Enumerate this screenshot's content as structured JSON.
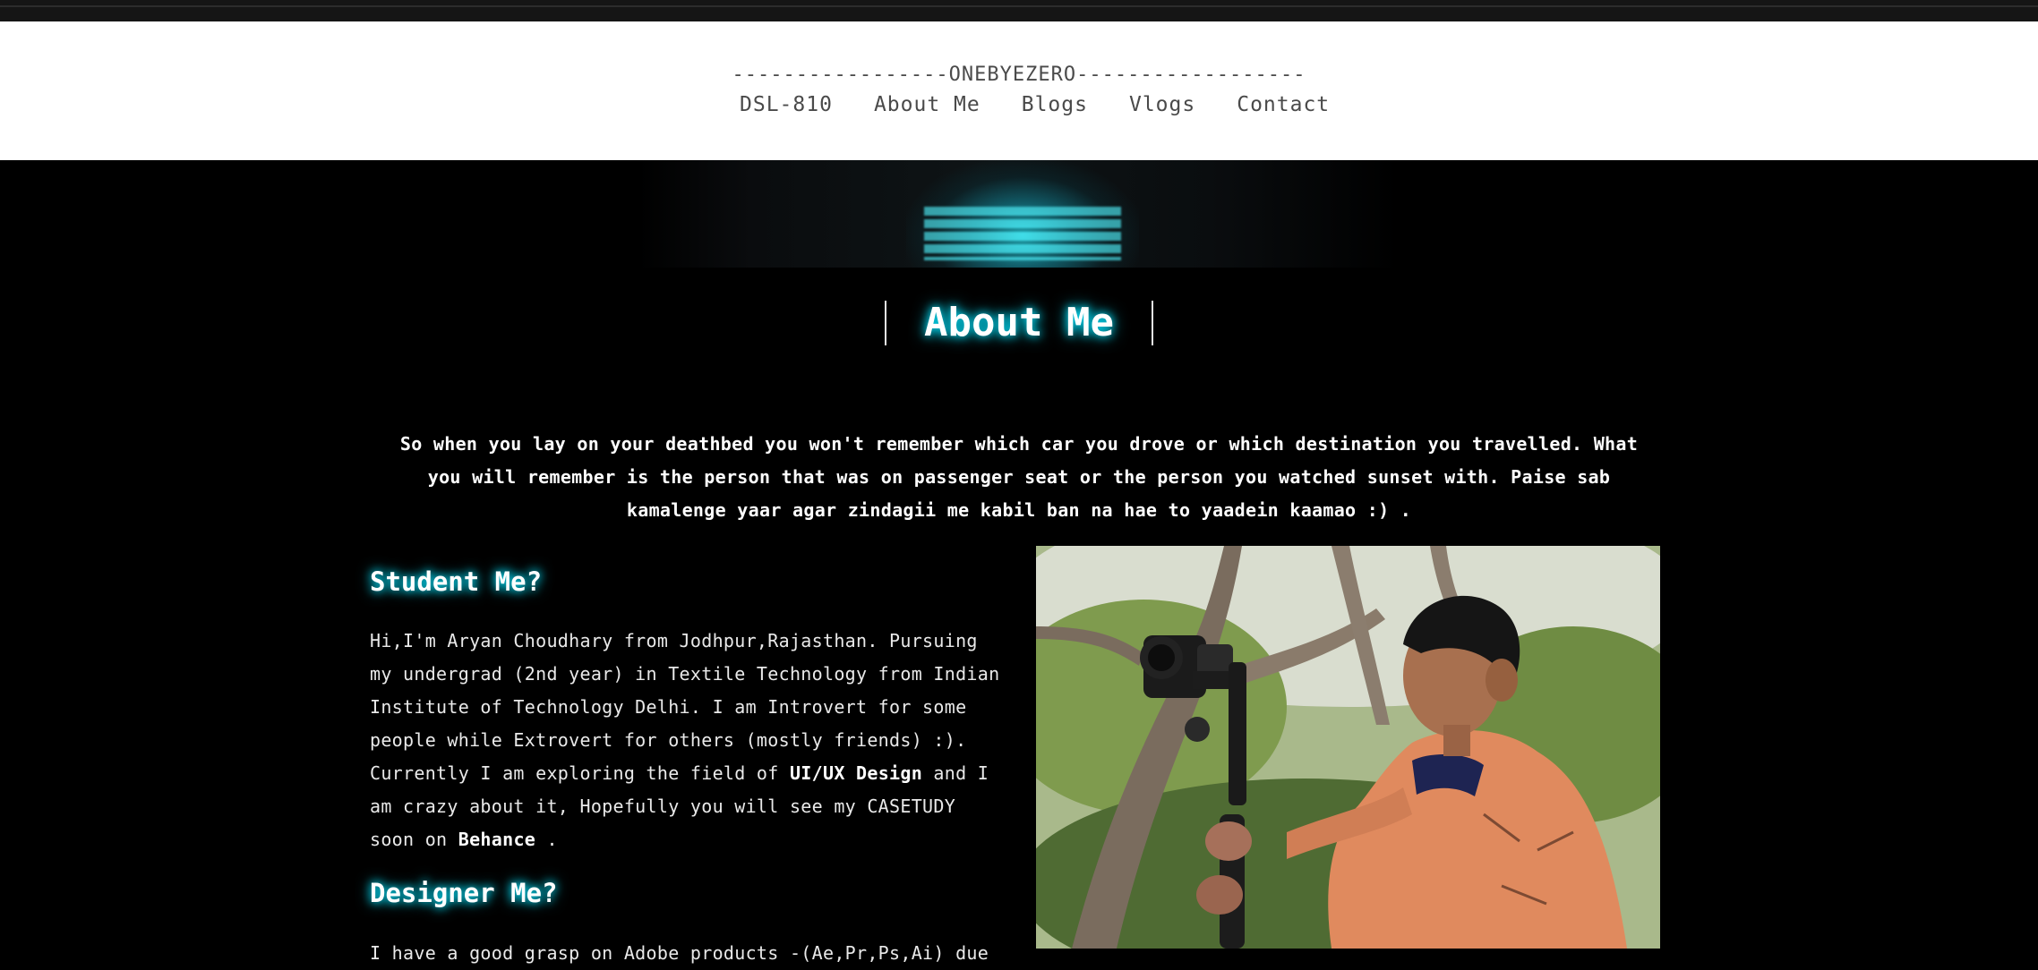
{
  "nav": {
    "brand": "-----------------ONEBYEZERO------------------",
    "items": [
      "DSL-810",
      "About Me",
      "Blogs",
      "Vlogs",
      "Contact"
    ]
  },
  "page": {
    "title": "About Me",
    "quote": "So when you lay on your deathbed you won't remember which car you drove or which destination you travelled. What you will remember is the person that was on passenger seat or the person you watched sunset with. Paise sab kamalenge yaar agar zindagii me kabil ban na hae to yaadein kaamao :) ."
  },
  "student": {
    "heading": "Student Me?",
    "text_1": "Hi,I'm Aryan Choudhary from Jodhpur,Rajasthan. Pursuing my undergrad (2nd year) in Textile Technology from Indian Institute of Technology Delhi. I am Introvert for some people while Extrovert for others (mostly friends) :). Currently I am exploring the field of ",
    "strong_1": "UI/UX Design",
    "text_2": " and I am crazy about it, Hopefully you will see my CASETUDY soon on ",
    "strong_2": "Behance",
    "text_3": " ."
  },
  "designer": {
    "heading": "Designer Me?",
    "text": "I have a good grasp on Adobe products -(Ae,Pr,Ps,Ai) due"
  },
  "colors": {
    "accent_glow": "#00e5ff",
    "background": "#000000",
    "header_bg": "#ffffff"
  }
}
